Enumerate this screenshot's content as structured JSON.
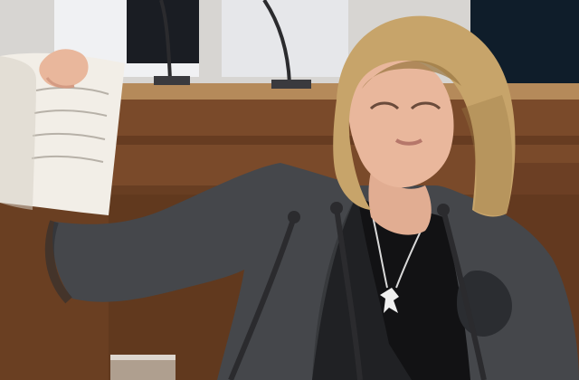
{
  "photo": {
    "subject": "woman",
    "setting": "parliament"
  },
  "colors": {
    "wood_dark": "#4f2c17",
    "wood_mid": "#7a4a2a",
    "wood_light": "#9b6a3f",
    "desk_top": "#b58a5a",
    "blazer": "#45474b",
    "blazer_shadow": "#2b2d31",
    "top": "#121214",
    "hair": "#c7a46a",
    "hair_shadow": "#9c7a45",
    "skin": "#e9b79c",
    "paper": "#f2eee7",
    "paper_shadow": "#d7d1c7",
    "mic": "#2b2b2e",
    "background_blue": "#0f1d2a",
    "background_white": "#eef0f2"
  }
}
